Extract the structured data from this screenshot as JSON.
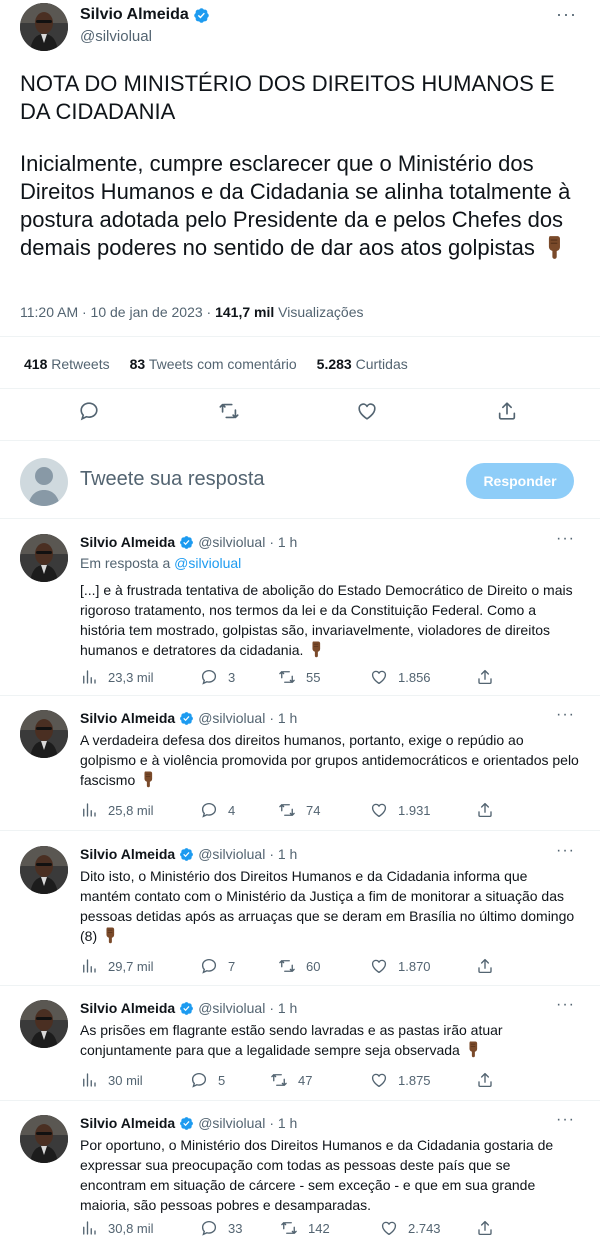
{
  "main": {
    "name": "Silvio Almeida",
    "handle": "@silviolual",
    "more": "···",
    "title": "NOTA DO MINISTÉRIO DOS DIREITOS HUMANOS E DA CIDADANIA",
    "body": "Inicialmente, cumpre esclarecer que o Ministério dos Direitos Humanos e da Cidadania se alinha totalmente à postura adotada pelo Presidente da e pelos Chefes dos demais poderes no sentido de dar aos atos golpistas",
    "time": "11:20 AM · 10 de jan de 2023 · ",
    "views_count": "141,7 mil",
    "views_label": " Visualizações",
    "retweets_count": "418",
    "retweets_label": " Retweets",
    "quotes_count": "83",
    "quotes_label": " Tweets com comentário",
    "likes_count": "5.283",
    "likes_label": " Curtidas"
  },
  "compose": {
    "placeholder": "Tweete sua resposta",
    "button": "Responder"
  },
  "replies": [
    {
      "name": "Silvio Almeida",
      "handle": "@silviolual",
      "time": "· 1 h",
      "in_reply_prefix": "Em resposta a ",
      "in_reply_handle": "@silviolual",
      "text": "[...] e à frustrada tentativa de abolição do Estado Democrático de Direito o mais rigoroso tratamento, nos termos da lei e da Constituição Federal. Como a história tem mostrado, golpistas são, invariavelmente, violadores de direitos humanos e detratores da cidadania.",
      "views": "23,3 mil",
      "replies": "3",
      "retweets": "55",
      "likes": "1.856"
    },
    {
      "name": "Silvio Almeida",
      "handle": "@silviolual",
      "time": "· 1 h",
      "text": "A verdadeira defesa dos direitos humanos, portanto, exige o repúdio ao golpismo e à violência promovida por grupos antidemocráticos e orientados pelo fascismo",
      "views": "25,8 mil",
      "replies": "4",
      "retweets": "74",
      "likes": "1.931"
    },
    {
      "name": "Silvio Almeida",
      "handle": "@silviolual",
      "time": "· 1 h",
      "text": "Dito isto, o Ministério dos Direitos Humanos e da Cidadania informa que mantém contato com o Ministério da Justiça a fim de monitorar a situação das pessoas detidas após as arruaças que se deram em Brasília no último domingo (8)",
      "views": "29,7 mil",
      "replies": "7",
      "retweets": "60",
      "likes": "1.870"
    },
    {
      "name": "Silvio Almeida",
      "handle": "@silviolual",
      "time": "· 1 h",
      "text": "As prisões em flagrante estão sendo lavradas e as pastas irão atuar conjuntamente para que a legalidade sempre seja observada",
      "views": "30 mil",
      "replies": "5",
      "retweets": "47",
      "likes": "1.875"
    },
    {
      "name": "Silvio Almeida",
      "handle": "@silviolual",
      "time": "· 1 h",
      "text": "Por oportuno, o Ministério dos Direitos Humanos e da Cidadania gostaria de expressar sua preocupação com todas as pessoas deste país que se encontram em situação de cárcere - sem exceção - e que em sua grande maioria, são pessoas pobres e desamparadas.",
      "views": "30,8 mil",
      "replies": "33",
      "retweets": "142",
      "likes": "2.743"
    }
  ],
  "colors": {
    "accent": "#1d9bf0",
    "button_disabled": "#8ecdf8",
    "muted": "#536471",
    "divider": "#eff3f4"
  },
  "icons": {
    "verified": "verified-badge-icon",
    "emoji": "backhand-index-pointing-down-emoji",
    "reply": "reply-icon",
    "retweet": "retweet-icon",
    "like": "heart-icon",
    "share": "share-icon",
    "views": "analytics-icon"
  }
}
